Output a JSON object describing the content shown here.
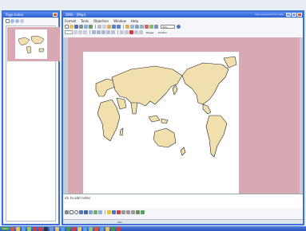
{
  "page_index_window": {
    "title": "Page Index"
  },
  "main_window": {
    "title": "DMO - [Map]",
    "search_hint": "Type a question for help",
    "menu": [
      "Format",
      "Tools",
      "Objection",
      "Window",
      "Help"
    ],
    "zoom_value": "45%",
    "formatting_buttons": [
      "Bigger",
      "Smaller"
    ],
    "notes_placeholder": "ick to add notes",
    "bottom_small_label": "Idol"
  },
  "taskbar": {
    "start_label": "Start"
  },
  "colors": {
    "window_border": "#3d6fd8",
    "title_bar": "#2c5ed0",
    "canvas_background": "#d8a9b2",
    "land": "#f1dfae",
    "page": "#ffffff"
  }
}
